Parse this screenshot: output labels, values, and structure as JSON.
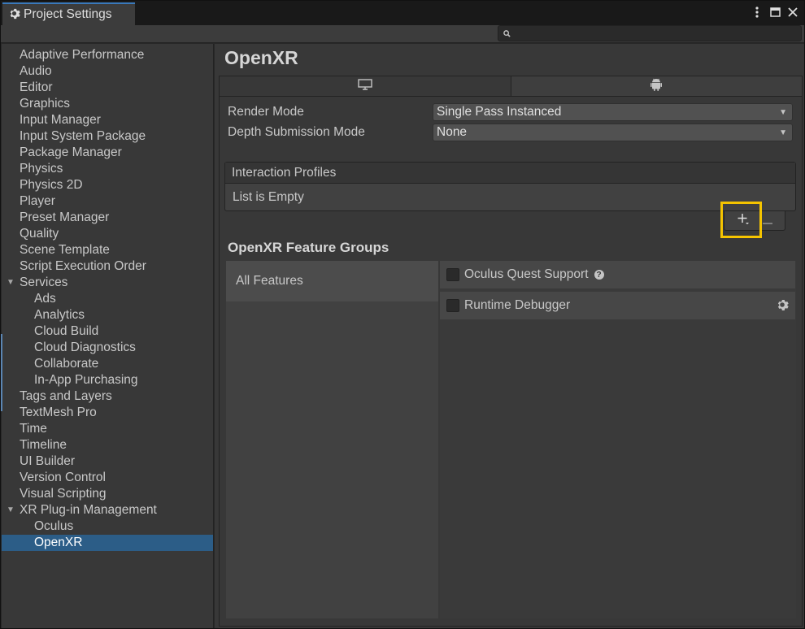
{
  "window": {
    "tab_title": "Project Settings",
    "title_icon": "gear-icon",
    "actions": [
      "more-vert-icon",
      "maximize-icon",
      "close-icon"
    ]
  },
  "search": {
    "placeholder": "",
    "value": ""
  },
  "sidebar": {
    "items": [
      {
        "label": "Adaptive Performance",
        "level": 0
      },
      {
        "label": "Audio",
        "level": 0
      },
      {
        "label": "Editor",
        "level": 0
      },
      {
        "label": "Graphics",
        "level": 0
      },
      {
        "label": "Input Manager",
        "level": 0
      },
      {
        "label": "Input System Package",
        "level": 0
      },
      {
        "label": "Package Manager",
        "level": 0
      },
      {
        "label": "Physics",
        "level": 0
      },
      {
        "label": "Physics 2D",
        "level": 0
      },
      {
        "label": "Player",
        "level": 0
      },
      {
        "label": "Preset Manager",
        "level": 0
      },
      {
        "label": "Quality",
        "level": 0
      },
      {
        "label": "Scene Template",
        "level": 0
      },
      {
        "label": "Script Execution Order",
        "level": 0
      },
      {
        "label": "Services",
        "level": 0,
        "expanded": true
      },
      {
        "label": "Ads",
        "level": 1
      },
      {
        "label": "Analytics",
        "level": 1
      },
      {
        "label": "Cloud Build",
        "level": 1
      },
      {
        "label": "Cloud Diagnostics",
        "level": 1
      },
      {
        "label": "Collaborate",
        "level": 1
      },
      {
        "label": "In-App Purchasing",
        "level": 1
      },
      {
        "label": "Tags and Layers",
        "level": 0
      },
      {
        "label": "TextMesh Pro",
        "level": 0
      },
      {
        "label": "Time",
        "level": 0
      },
      {
        "label": "Timeline",
        "level": 0
      },
      {
        "label": "UI Builder",
        "level": 0
      },
      {
        "label": "Version Control",
        "level": 0
      },
      {
        "label": "Visual Scripting",
        "level": 0
      },
      {
        "label": "XR Plug-in Management",
        "level": 0,
        "expanded": true
      },
      {
        "label": "Oculus",
        "level": 1
      },
      {
        "label": "OpenXR",
        "level": 1,
        "selected": true
      }
    ]
  },
  "main": {
    "title": "OpenXR",
    "platform_tabs": [
      {
        "icon": "desktop-icon",
        "active": false
      },
      {
        "icon": "android-icon",
        "active": true
      }
    ],
    "render_mode": {
      "label": "Render Mode",
      "value": "Single Pass Instanced"
    },
    "depth_mode": {
      "label": "Depth Submission Mode",
      "value": "None"
    },
    "interaction_profiles": {
      "header": "Interaction Profiles",
      "empty_text": "List is Empty"
    },
    "list_buttons": {
      "add": "+",
      "remove": "−"
    },
    "feature_groups": {
      "title": "OpenXR Feature Groups",
      "groups": [
        "All Features"
      ],
      "features": [
        {
          "label": "Oculus Quest Support",
          "checked": false,
          "icon": "help-icon"
        },
        {
          "label": "Runtime Debugger",
          "checked": false,
          "icon": "gear-icon"
        }
      ]
    }
  },
  "colors": {
    "selection": "#2c5d87",
    "highlight": "#f5c400",
    "panel": "#383838"
  }
}
